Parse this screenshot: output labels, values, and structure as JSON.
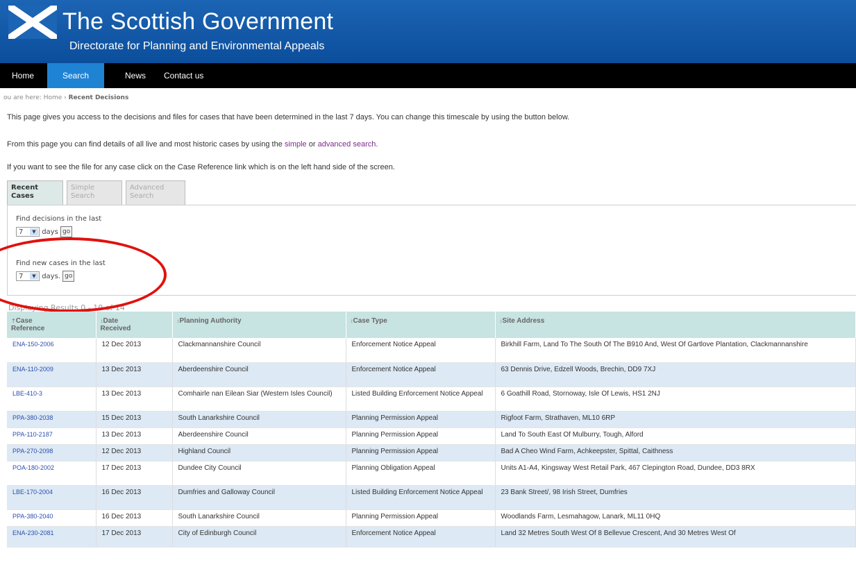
{
  "header": {
    "title": "The Scottish Government",
    "subtitle": "Directorate for Planning and Environmental Appeals"
  },
  "nav": {
    "home": "Home",
    "search": "Search",
    "news": "News",
    "contact": "Contact us"
  },
  "breadcrumb": {
    "prefix": "ou are here:",
    "home": "Home",
    "separator": "›",
    "current": "Recent Decisions"
  },
  "intro": {
    "p1": "This page gives you access to the decisions and files for cases that have been determined in the last 7 days. You can change this timescale by using the button below.",
    "p2_before": "From this page you can find details of all live and most historic cases by using the",
    "p2_link1": "simple",
    "p2_mid": "or",
    "p2_link2": "advanced search",
    "p2_after": ".",
    "p3": "If you want to see the file for any case click on the Case Reference link which is on the left hand side of the screen."
  },
  "tabs": {
    "recent": [
      "Recent",
      "Cases"
    ],
    "simple": [
      "Simple",
      "Search"
    ],
    "advanced": [
      "Advanced",
      "Search"
    ]
  },
  "find": {
    "decisions_label": "Find decisions in the last",
    "decisions_value": "7",
    "decisions_unit": "days",
    "new_label": "Find new cases in the last",
    "new_value": "7",
    "new_unit": "days.",
    "go": "go"
  },
  "results_text": "Displaying Results 0 - 10 of 14",
  "table": {
    "headers": {
      "ref": [
        "Case",
        "Reference"
      ],
      "date": [
        "Date",
        "Received"
      ],
      "authority": "Planning Authority",
      "type": "Case Type",
      "address": "Site Address"
    },
    "rows": [
      {
        "ref": "ENA-150-2006",
        "date": "12 Dec 2013",
        "authority": "Clackmannanshire Council",
        "type": "Enforcement Notice Appeal",
        "address": "Birkhill Farm, Land To The South Of The B910 And, West Of Gartlove Plantation, Clackmannanshire"
      },
      {
        "ref": "ENA-110-2009",
        "date": "13 Dec 2013",
        "authority": "Aberdeenshire Council",
        "type": "Enforcement Notice Appeal",
        "address": "63 Dennis Drive, Edzell Woods, Brechin, DD9 7XJ"
      },
      {
        "ref": "LBE-410-3",
        "date": "13 Dec 2013",
        "authority": "Comhairle nan Eilean Siar (Western Isles Council)",
        "type": "Listed Building Enforcement Notice Appeal",
        "address": "6 Goathill Road, Stornoway, Isle Of Lewis, HS1 2NJ"
      },
      {
        "ref": "PPA-380-2038",
        "date": "15 Dec 2013",
        "authority": "South Lanarkshire Council",
        "type": "Planning Permission Appeal",
        "address": "Rigfoot Farm, Strathaven, ML10 6RP"
      },
      {
        "ref": "PPA-110-2187",
        "date": "13 Dec 2013",
        "authority": "Aberdeenshire Council",
        "type": "Planning Permission Appeal",
        "address": "Land To South East Of Mulburry, Tough, Alford"
      },
      {
        "ref": "PPA-270-2098",
        "date": "12 Dec 2013",
        "authority": "Highland Council",
        "type": "Planning Permission Appeal",
        "address": "Bad A Cheo Wind Farm, Achkeepster, Spittal, Caithness"
      },
      {
        "ref": "POA-180-2002",
        "date": "17 Dec 2013",
        "authority": "Dundee City Council",
        "type": "Planning Obligation Appeal",
        "address": "Units A1-A4, Kingsway West Retail Park, 467 Clepington Road, Dundee, DD3 8RX"
      },
      {
        "ref": "LBE-170-2004",
        "date": "16 Dec 2013",
        "authority": "Dumfries and Galloway Council",
        "type": "Listed Building Enforcement Notice Appeal",
        "address": "23 Bank Street/, 98 Irish Street, Dumfries"
      },
      {
        "ref": "PPA-380-2040",
        "date": "16 Dec 2013",
        "authority": "South Lanarkshire Council",
        "type": "Planning Permission Appeal",
        "address": "Woodlands Farm, Lesmahagow, Lanark, ML11 0HQ"
      },
      {
        "ref": "ENA-230-2081",
        "date": "17 Dec 2013",
        "authority": "City of Edinburgh Council",
        "type": "Enforcement Notice Appeal",
        "address": "Land 32 Metres South West Of 8 Bellevue Crescent, And 30 Metres West Of"
      }
    ]
  },
  "colors": {
    "header_blue": "#1c64b4",
    "nav_active": "#1f83d4",
    "annotation_red": "#e0110e",
    "row_alt": "#dde9f4",
    "table_header": "#c7e3e2"
  }
}
